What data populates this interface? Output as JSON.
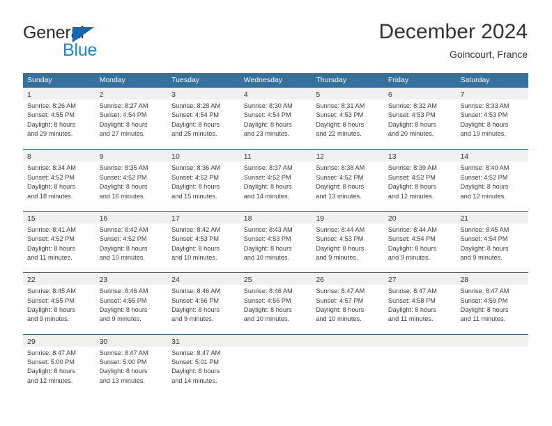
{
  "brand": {
    "word_one": "General",
    "word_two": "Blue",
    "triangle_icon": "brand-triangle-icon"
  },
  "header": {
    "title": "December 2024",
    "location": "Goincourt, France"
  },
  "calendar": {
    "weekdays": [
      "Sunday",
      "Monday",
      "Tuesday",
      "Wednesday",
      "Thursday",
      "Friday",
      "Saturday"
    ],
    "colors": {
      "header_blue": "#35719d",
      "row_divider_blue": "#2b6ca3",
      "date_band_gray": "#f0f0f0",
      "brand_blue": "#1887d6",
      "brand_triangle_blue": "#1268b3"
    },
    "weeks": [
      [
        {
          "day": "1",
          "sunrise": "Sunrise: 8:26 AM",
          "sunset": "Sunset: 4:55 PM",
          "daylight_line1": "Daylight: 8 hours",
          "daylight_line2": "and 29 minutes."
        },
        {
          "day": "2",
          "sunrise": "Sunrise: 8:27 AM",
          "sunset": "Sunset: 4:54 PM",
          "daylight_line1": "Daylight: 8 hours",
          "daylight_line2": "and 27 minutes."
        },
        {
          "day": "3",
          "sunrise": "Sunrise: 8:28 AM",
          "sunset": "Sunset: 4:54 PM",
          "daylight_line1": "Daylight: 8 hours",
          "daylight_line2": "and 25 minutes."
        },
        {
          "day": "4",
          "sunrise": "Sunrise: 8:30 AM",
          "sunset": "Sunset: 4:54 PM",
          "daylight_line1": "Daylight: 8 hours",
          "daylight_line2": "and 23 minutes."
        },
        {
          "day": "5",
          "sunrise": "Sunrise: 8:31 AM",
          "sunset": "Sunset: 4:53 PM",
          "daylight_line1": "Daylight: 8 hours",
          "daylight_line2": "and 22 minutes."
        },
        {
          "day": "6",
          "sunrise": "Sunrise: 8:32 AM",
          "sunset": "Sunset: 4:53 PM",
          "daylight_line1": "Daylight: 8 hours",
          "daylight_line2": "and 20 minutes."
        },
        {
          "day": "7",
          "sunrise": "Sunrise: 8:33 AM",
          "sunset": "Sunset: 4:53 PM",
          "daylight_line1": "Daylight: 8 hours",
          "daylight_line2": "and 19 minutes."
        }
      ],
      [
        {
          "day": "8",
          "sunrise": "Sunrise: 8:34 AM",
          "sunset": "Sunset: 4:52 PM",
          "daylight_line1": "Daylight: 8 hours",
          "daylight_line2": "and 18 minutes."
        },
        {
          "day": "9",
          "sunrise": "Sunrise: 8:35 AM",
          "sunset": "Sunset: 4:52 PM",
          "daylight_line1": "Daylight: 8 hours",
          "daylight_line2": "and 16 minutes."
        },
        {
          "day": "10",
          "sunrise": "Sunrise: 8:36 AM",
          "sunset": "Sunset: 4:52 PM",
          "daylight_line1": "Daylight: 8 hours",
          "daylight_line2": "and 15 minutes."
        },
        {
          "day": "11",
          "sunrise": "Sunrise: 8:37 AM",
          "sunset": "Sunset: 4:52 PM",
          "daylight_line1": "Daylight: 8 hours",
          "daylight_line2": "and 14 minutes."
        },
        {
          "day": "12",
          "sunrise": "Sunrise: 8:38 AM",
          "sunset": "Sunset: 4:52 PM",
          "daylight_line1": "Daylight: 8 hours",
          "daylight_line2": "and 13 minutes."
        },
        {
          "day": "13",
          "sunrise": "Sunrise: 8:39 AM",
          "sunset": "Sunset: 4:52 PM",
          "daylight_line1": "Daylight: 8 hours",
          "daylight_line2": "and 12 minutes."
        },
        {
          "day": "14",
          "sunrise": "Sunrise: 8:40 AM",
          "sunset": "Sunset: 4:52 PM",
          "daylight_line1": "Daylight: 8 hours",
          "daylight_line2": "and 12 minutes."
        }
      ],
      [
        {
          "day": "15",
          "sunrise": "Sunrise: 8:41 AM",
          "sunset": "Sunset: 4:52 PM",
          "daylight_line1": "Daylight: 8 hours",
          "daylight_line2": "and 11 minutes."
        },
        {
          "day": "16",
          "sunrise": "Sunrise: 8:42 AM",
          "sunset": "Sunset: 4:52 PM",
          "daylight_line1": "Daylight: 8 hours",
          "daylight_line2": "and 10 minutes."
        },
        {
          "day": "17",
          "sunrise": "Sunrise: 8:42 AM",
          "sunset": "Sunset: 4:53 PM",
          "daylight_line1": "Daylight: 8 hours",
          "daylight_line2": "and 10 minutes."
        },
        {
          "day": "18",
          "sunrise": "Sunrise: 8:43 AM",
          "sunset": "Sunset: 4:53 PM",
          "daylight_line1": "Daylight: 8 hours",
          "daylight_line2": "and 10 minutes."
        },
        {
          "day": "19",
          "sunrise": "Sunrise: 8:44 AM",
          "sunset": "Sunset: 4:53 PM",
          "daylight_line1": "Daylight: 8 hours",
          "daylight_line2": "and 9 minutes."
        },
        {
          "day": "20",
          "sunrise": "Sunrise: 8:44 AM",
          "sunset": "Sunset: 4:54 PM",
          "daylight_line1": "Daylight: 8 hours",
          "daylight_line2": "and 9 minutes."
        },
        {
          "day": "21",
          "sunrise": "Sunrise: 8:45 AM",
          "sunset": "Sunset: 4:54 PM",
          "daylight_line1": "Daylight: 8 hours",
          "daylight_line2": "and 9 minutes."
        }
      ],
      [
        {
          "day": "22",
          "sunrise": "Sunrise: 8:45 AM",
          "sunset": "Sunset: 4:55 PM",
          "daylight_line1": "Daylight: 8 hours",
          "daylight_line2": "and 9 minutes."
        },
        {
          "day": "23",
          "sunrise": "Sunrise: 8:46 AM",
          "sunset": "Sunset: 4:55 PM",
          "daylight_line1": "Daylight: 8 hours",
          "daylight_line2": "and 9 minutes."
        },
        {
          "day": "24",
          "sunrise": "Sunrise: 8:46 AM",
          "sunset": "Sunset: 4:56 PM",
          "daylight_line1": "Daylight: 8 hours",
          "daylight_line2": "and 9 minutes."
        },
        {
          "day": "25",
          "sunrise": "Sunrise: 8:46 AM",
          "sunset": "Sunset: 4:56 PM",
          "daylight_line1": "Daylight: 8 hours",
          "daylight_line2": "and 10 minutes."
        },
        {
          "day": "26",
          "sunrise": "Sunrise: 8:47 AM",
          "sunset": "Sunset: 4:57 PM",
          "daylight_line1": "Daylight: 8 hours",
          "daylight_line2": "and 10 minutes."
        },
        {
          "day": "27",
          "sunrise": "Sunrise: 8:47 AM",
          "sunset": "Sunset: 4:58 PM",
          "daylight_line1": "Daylight: 8 hours",
          "daylight_line2": "and 11 minutes."
        },
        {
          "day": "28",
          "sunrise": "Sunrise: 8:47 AM",
          "sunset": "Sunset: 4:59 PM",
          "daylight_line1": "Daylight: 8 hours",
          "daylight_line2": "and 11 minutes."
        }
      ],
      [
        {
          "day": "29",
          "sunrise": "Sunrise: 8:47 AM",
          "sunset": "Sunset: 5:00 PM",
          "daylight_line1": "Daylight: 8 hours",
          "daylight_line2": "and 12 minutes."
        },
        {
          "day": "30",
          "sunrise": "Sunrise: 8:47 AM",
          "sunset": "Sunset: 5:00 PM",
          "daylight_line1": "Daylight: 8 hours",
          "daylight_line2": "and 13 minutes."
        },
        {
          "day": "31",
          "sunrise": "Sunrise: 8:47 AM",
          "sunset": "Sunset: 5:01 PM",
          "daylight_line1": "Daylight: 8 hours",
          "daylight_line2": "and 14 minutes."
        },
        {
          "day": "",
          "sunrise": "",
          "sunset": "",
          "daylight_line1": "",
          "daylight_line2": ""
        },
        {
          "day": "",
          "sunrise": "",
          "sunset": "",
          "daylight_line1": "",
          "daylight_line2": ""
        },
        {
          "day": "",
          "sunrise": "",
          "sunset": "",
          "daylight_line1": "",
          "daylight_line2": ""
        },
        {
          "day": "",
          "sunrise": "",
          "sunset": "",
          "daylight_line1": "",
          "daylight_line2": ""
        }
      ]
    ]
  }
}
